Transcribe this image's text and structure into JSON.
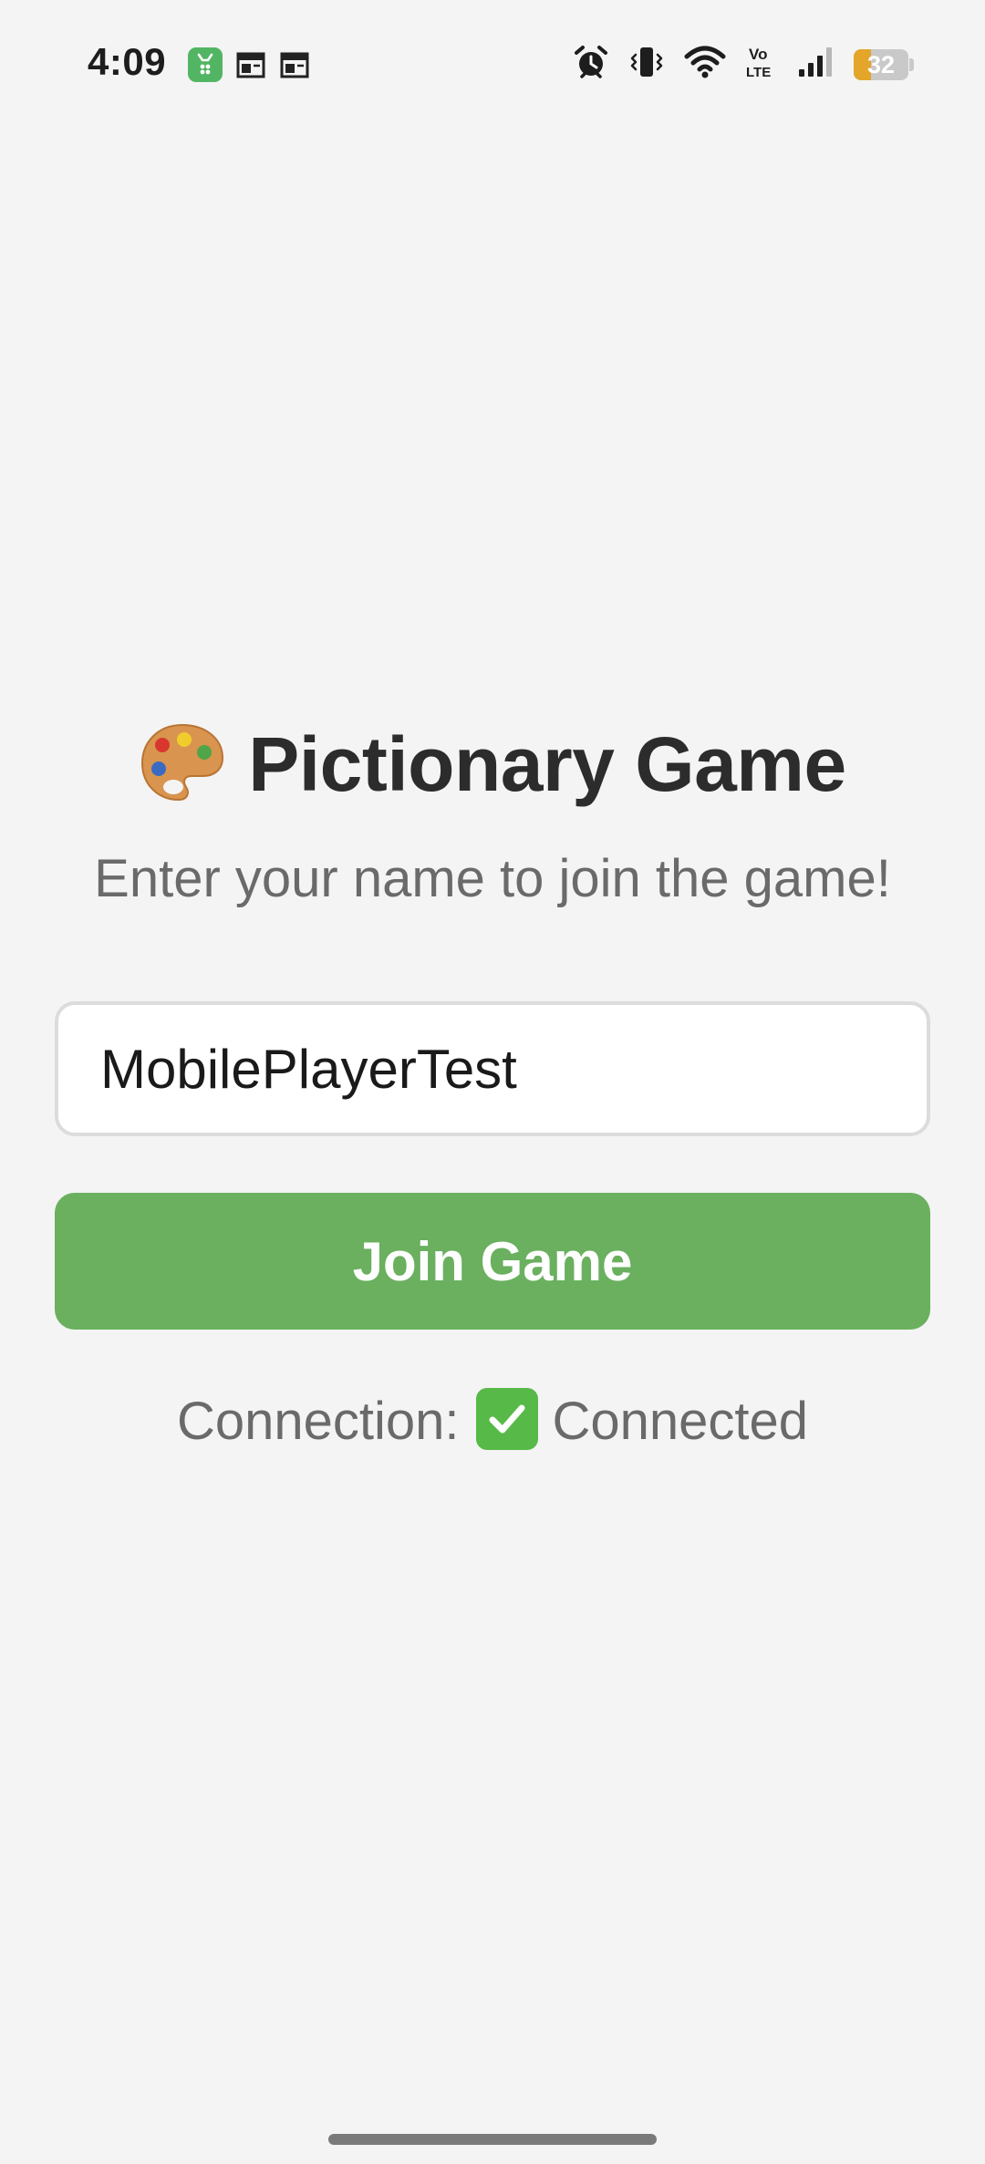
{
  "status_bar": {
    "time": "4:09",
    "battery_level": "32",
    "battery_fraction": 0.32,
    "battery_color": "#e3a52a",
    "icons": [
      "app-notification-icon",
      "calendar-icon",
      "calendar-icon",
      "alarm-icon",
      "vibrate-icon",
      "wifi-icon",
      "volte-icon",
      "signal-icon",
      "battery-icon"
    ]
  },
  "main": {
    "title": "Pictionary Game",
    "title_icon": "palette-icon",
    "subtitle": "Enter your name to join the game!",
    "name_input_value": "MobilePlayerTest",
    "join_button_label": "Join Game",
    "connection_label": "Connection:",
    "connection_status": "Connected",
    "connection_icon": "check-mark-icon",
    "accent_color": "#6ab05f"
  }
}
